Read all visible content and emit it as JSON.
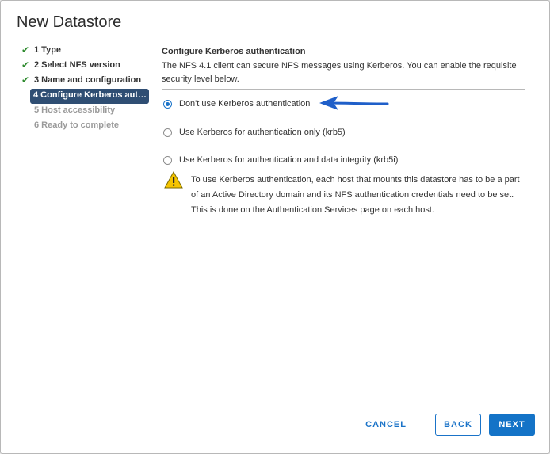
{
  "dialog": {
    "title": "New Datastore"
  },
  "steps": [
    {
      "label": "1 Type",
      "state": "done"
    },
    {
      "label": "2 Select NFS version",
      "state": "done"
    },
    {
      "label": "3 Name and configuration",
      "state": "done"
    },
    {
      "label": "4 Configure Kerberos auth...",
      "state": "active"
    },
    {
      "label": "5 Host accessibility",
      "state": "future"
    },
    {
      "label": "6 Ready to complete",
      "state": "future"
    }
  ],
  "content": {
    "section_title": "Configure Kerberos authentication",
    "description": "The NFS 4.1 client can secure NFS messages using Kerberos. You can enable the requisite security level below.",
    "options": [
      {
        "label": "Don't use Kerberos authentication",
        "selected": true
      },
      {
        "label": "Use Kerberos for authentication only (krb5)",
        "selected": false
      },
      {
        "label": "Use Kerberos for authentication and data integrity (krb5i)",
        "selected": false
      }
    ],
    "warning": "To use Kerberos authentication, each host that mounts this datastore has to be a part of an Active Directory domain and its NFS authentication credentials need to be set. This is done on the Authentication Services page on each host."
  },
  "footer": {
    "cancel_label": "CANCEL",
    "back_label": "BACK",
    "next_label": "NEXT"
  },
  "colors": {
    "primary": "#1473c7",
    "active_step": "#2f4e73",
    "check": "#2e8a2e",
    "warning": "#f5c400"
  },
  "icons": {
    "done_step": "check-icon",
    "warning": "warning-icon",
    "annotation": "arrow-icon"
  }
}
